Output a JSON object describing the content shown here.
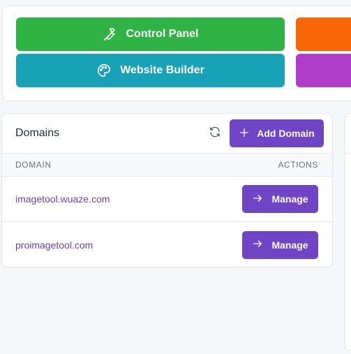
{
  "quick_actions": {
    "control_panel_label": "Control Panel",
    "website_builder_label": "Website Builder",
    "colors": {
      "control_panel": "#2eb344",
      "website_builder": "#17a2b8",
      "orange": "#f76707",
      "purple": "#ae3ec9"
    }
  },
  "domains": {
    "title": "Domains",
    "add_label": "Add Domain",
    "columns": {
      "domain": "DOMAIN",
      "actions": "ACTIONS"
    },
    "rows": [
      {
        "domain": "imagetool.wuaze.com",
        "action": "Manage"
      },
      {
        "domain": "proimagetool.com",
        "action": "Manage"
      }
    ]
  },
  "accent_color": "#7045c5"
}
